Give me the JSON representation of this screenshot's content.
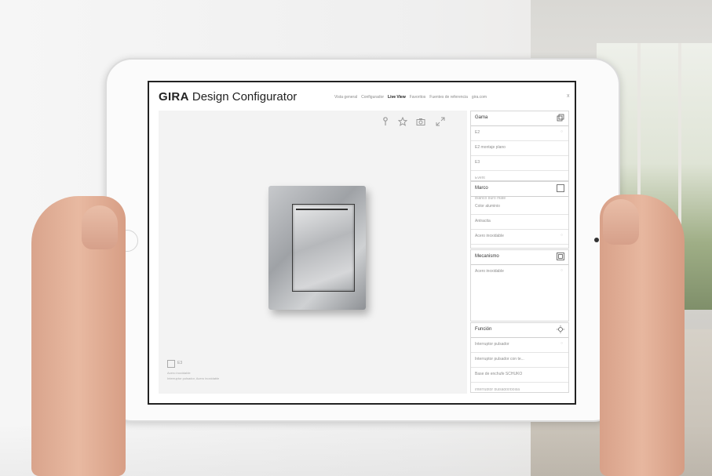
{
  "header": {
    "brand": "GIRA",
    "app_name": "Design Configurator",
    "nav": [
      {
        "label": "Vista general",
        "active": false
      },
      {
        "label": "Configurador",
        "active": false
      },
      {
        "label": "Live View",
        "active": true
      },
      {
        "label": "Favoritos",
        "active": false
      },
      {
        "label": "Fuentes de referencia",
        "active": false
      },
      {
        "label": "gira.com",
        "active": false
      }
    ],
    "close_glyph": "x"
  },
  "preview": {
    "toolbar_icons": [
      "pin-icon",
      "star-icon",
      "camera-icon",
      "expand-icon"
    ],
    "summary_code": "E3",
    "summary_lines": [
      "Acero inoxidable",
      "Interruptor pulsador, Acero inoxidable"
    ]
  },
  "panels": {
    "gama": {
      "title": "Gama",
      "items": [
        {
          "label": "E2",
          "checked": true
        },
        {
          "label": "E2 montaje plano",
          "checked": false
        },
        {
          "label": "E3",
          "checked": false
        }
      ],
      "clipped": "Event"
    },
    "marco": {
      "title": "Marco",
      "clipped": "Blanco puro mate",
      "items": [
        {
          "label": "Color aluminio",
          "checked": false
        },
        {
          "label": "Antracita",
          "checked": false
        },
        {
          "label": "Acero inoxidable",
          "checked": true
        }
      ]
    },
    "mecanismo": {
      "title": "Mecanismo",
      "items": [
        {
          "label": "Acero inoxidable",
          "checked": true
        }
      ]
    },
    "funcion": {
      "title": "Función",
      "items": [
        {
          "label": "Interruptor pulsador",
          "checked": true
        },
        {
          "label": "Interruptor pulsador con te...",
          "checked": false
        },
        {
          "label": "Base de enchufe SCHUKO",
          "checked": false
        }
      ],
      "clipped": "Interruptor pulsador/bolsa"
    }
  },
  "colors": {
    "screen_bg": "#ffffff",
    "preview_bg": "#f3f3f3",
    "switch_metal": "#b6b8bb"
  }
}
